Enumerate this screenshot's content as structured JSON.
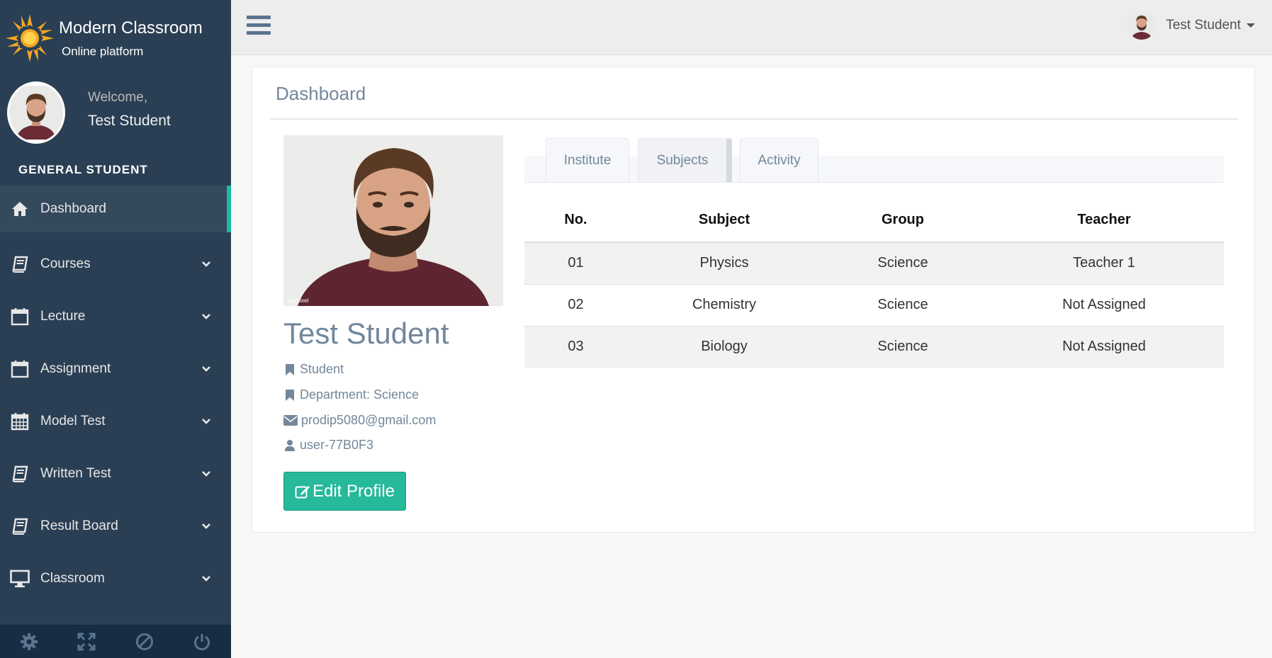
{
  "brand": {
    "title": "Modern Classroom",
    "subtitle": "Online platform",
    "logo_icon": "sun-logo-icon"
  },
  "sidebar": {
    "welcome": "Welcome,",
    "user_name": "Test Student",
    "section_title": "GENERAL STUDENT",
    "items": [
      {
        "label": "Dashboard",
        "icon": "home-icon",
        "active": true
      },
      {
        "label": "Courses",
        "icon": "book-icon"
      },
      {
        "label": "Lecture",
        "icon": "calendar-icon"
      },
      {
        "label": "Assignment",
        "icon": "calendar-icon"
      },
      {
        "label": "Model Test",
        "icon": "calendar-grid-icon"
      },
      {
        "label": "Written Test",
        "icon": "book-icon"
      },
      {
        "label": "Result Board",
        "icon": "book-icon"
      },
      {
        "label": "Classroom",
        "icon": "desktop-icon"
      }
    ],
    "footer_icons": [
      "gear-icon",
      "fullscreen-icon",
      "ban-icon",
      "power-icon"
    ]
  },
  "topnav": {
    "user_name": "Test Student"
  },
  "panel": {
    "title": "Dashboard"
  },
  "profile": {
    "name": "Test Student",
    "role": "Student",
    "department": "Department: Science",
    "email": "prodip5080@gmail.com",
    "user_id": "user-77B0F3",
    "edit_label": "Edit Profile",
    "photo_watermark": "rawpixel"
  },
  "tabs": [
    {
      "label": "Institute"
    },
    {
      "label": "Subjects",
      "active": true
    },
    {
      "label": "Activity"
    }
  ],
  "table": {
    "headers": [
      "No.",
      "Subject",
      "Group",
      "Teacher"
    ],
    "rows": [
      [
        "01",
        "Physics",
        "Science",
        "Teacher 1"
      ],
      [
        "02",
        "Chemistry",
        "Science",
        "Not Assigned"
      ],
      [
        "03",
        "Biology",
        "Science",
        "Not Assigned"
      ]
    ]
  },
  "colors": {
    "sidebar": "#2a3f54",
    "accent": "#1abb9c",
    "button": "#26b99a"
  }
}
